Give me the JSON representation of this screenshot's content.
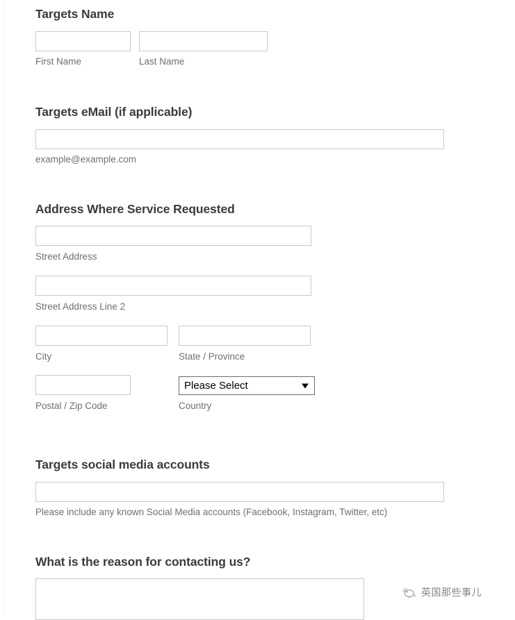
{
  "form": {
    "sections": [
      {
        "id": "targets-name",
        "heading": "Targets Name",
        "fields": [
          {
            "id": "first-name",
            "label": "First Name",
            "value": "",
            "placeholder": ""
          },
          {
            "id": "last-name",
            "label": "Last Name",
            "value": "",
            "placeholder": ""
          }
        ]
      },
      {
        "id": "targets-email",
        "heading": "Targets eMail (if applicable)",
        "fields": [
          {
            "id": "email",
            "label": "example@example.com",
            "value": "",
            "placeholder": ""
          }
        ]
      },
      {
        "id": "service-address",
        "heading": "Address Where Service Requested",
        "fields": [
          {
            "id": "street-address",
            "label": "Street Address",
            "value": "",
            "placeholder": ""
          },
          {
            "id": "street-address-2",
            "label": "Street Address Line 2",
            "value": "",
            "placeholder": ""
          },
          {
            "id": "city",
            "label": "City",
            "value": "",
            "placeholder": ""
          },
          {
            "id": "state",
            "label": "State / Province",
            "value": "",
            "placeholder": ""
          },
          {
            "id": "postal",
            "label": "Postal / Zip Code",
            "value": "",
            "placeholder": ""
          },
          {
            "id": "country",
            "label": "Country",
            "value": "Please Select",
            "placeholder": ""
          }
        ]
      },
      {
        "id": "social-media",
        "heading": "Targets social media accounts",
        "fields": [
          {
            "id": "social-accounts",
            "label": "Please include any known Social Media accounts (Facebook, Instagram, Twitter, etc)",
            "value": "",
            "placeholder": ""
          }
        ]
      },
      {
        "id": "contact-reason",
        "heading": "What is the reason for contacting us?",
        "fields": [
          {
            "id": "reason",
            "label": "",
            "value": "",
            "placeholder": ""
          }
        ]
      }
    ],
    "country_options": [
      "Please Select"
    ]
  },
  "watermark": {
    "text": "英国那些事儿",
    "icon": "bird-icon"
  },
  "colors": {
    "heading": "#3b3b3b",
    "sub_label": "#6f6f6f",
    "input_border": "#c9c9c9",
    "select_border": "#6b6b6b",
    "background": "#ffffff"
  }
}
